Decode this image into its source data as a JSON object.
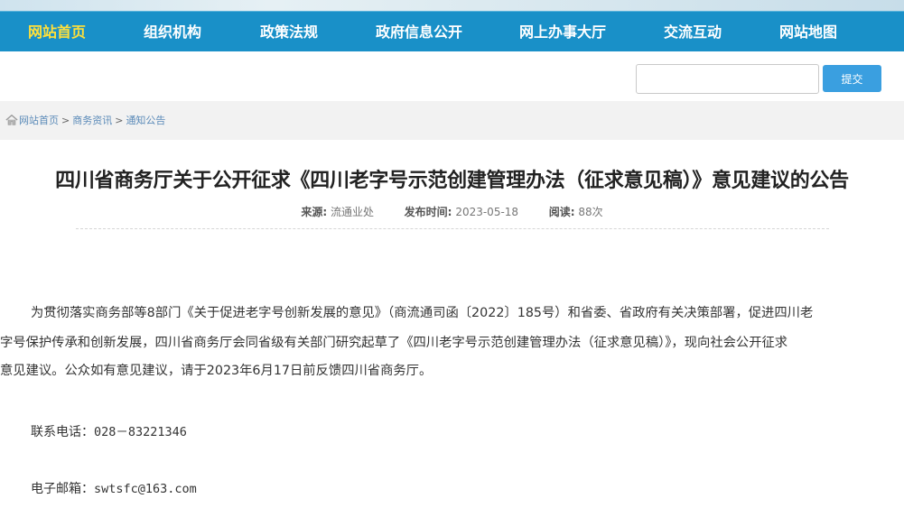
{
  "nav": {
    "items": [
      {
        "label": "网站首页",
        "active": true
      },
      {
        "label": "组织机构"
      },
      {
        "label": "政策法规"
      },
      {
        "label": "政府信息公开"
      },
      {
        "label": "网上办事大厅"
      },
      {
        "label": "交流互动"
      },
      {
        "label": "网站地图"
      }
    ]
  },
  "search": {
    "value": "",
    "button_label": "提交"
  },
  "breadcrumb": {
    "items": [
      "网站首页",
      "商务资讯",
      "通知公告"
    ],
    "separator": ">"
  },
  "article": {
    "title": "四川省商务厅关于公开征求《四川老字号示范创建管理办法（征求意见稿）》意见建议的公告",
    "meta": {
      "source_label": "来源:",
      "source": "流通业处",
      "date_label": "发布时间:",
      "date": "2023-05-18",
      "views_label": "阅读:",
      "views": "88次"
    },
    "body": {
      "line1": "为贯彻落实商务部等8部门《关于促进老字号创新发展的意见》（商流通司函〔2022〕185号）和省委、省政府有关决策部署，促进四川老",
      "line2": "字号保护传承和创新发展，四川省商务厅会同省级有关部门研究起草了《四川老字号示范创建管理办法（征求意见稿）》，现向社会公开征求",
      "line3": "意见建议。公众如有意见建议，请于2023年6月17日前反馈四川省商务厅。"
    },
    "contact": {
      "phone_label": "联系电话：",
      "phone": "028－83221346",
      "email_label": "电子邮箱：",
      "email": "swtsfc@163.com"
    }
  },
  "colors": {
    "nav_bg": "#1990c8",
    "nav_active": "#ffe03a",
    "button": "#3a9fe0",
    "link": "#5a8ab8"
  }
}
